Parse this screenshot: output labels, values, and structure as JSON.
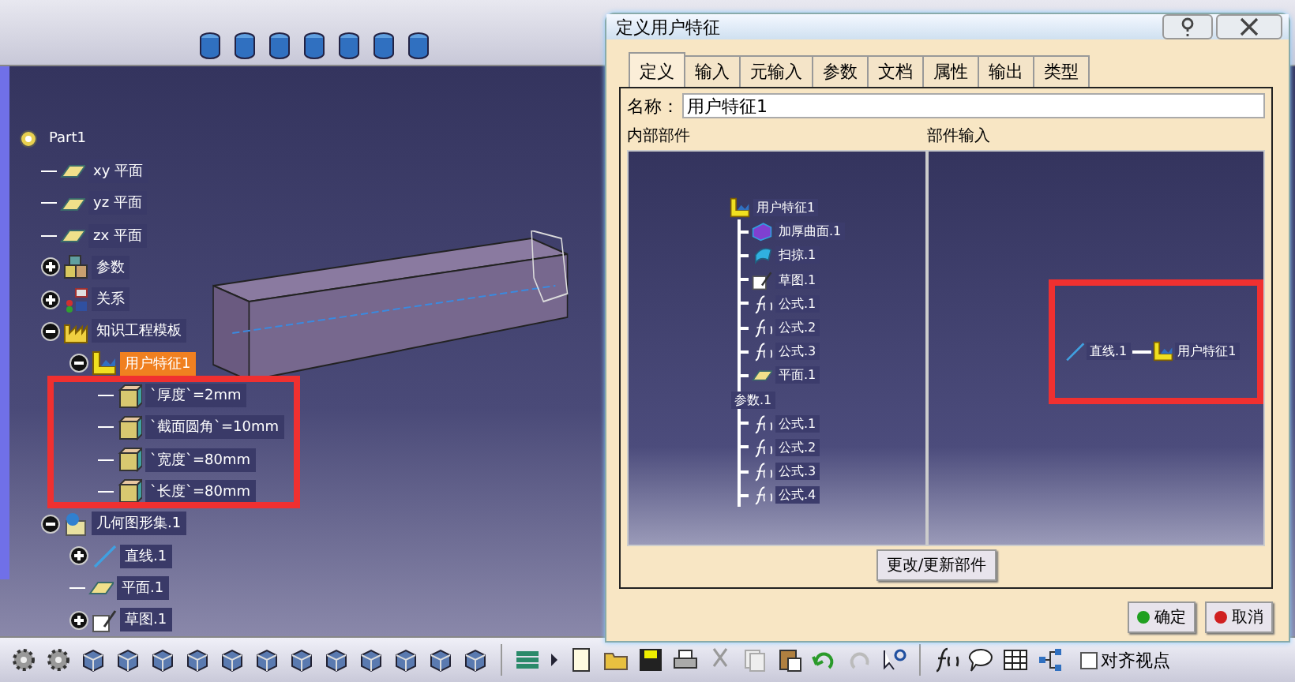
{
  "tree": {
    "label": "Part1",
    "kind": "part",
    "selected": false,
    "children": [
      {
        "label": "xy 平面",
        "kind": "plane",
        "selected": false
      },
      {
        "label": "yz 平面",
        "kind": "plane",
        "selected": false
      },
      {
        "label": "zx 平面",
        "kind": "plane",
        "selected": false
      },
      {
        "label": "参数",
        "kind": "params",
        "selected": false,
        "expanded": false
      },
      {
        "label": "关系",
        "kind": "relations",
        "selected": false,
        "expanded": false
      },
      {
        "label": "知识工程模板",
        "kind": "template",
        "selected": false,
        "expanded": true,
        "children": [
          {
            "label": "用户特征1",
            "kind": "feature",
            "selected": true,
            "expanded": true,
            "children": [
              {
                "label": "`厚度`=2mm",
                "kind": "param",
                "selected": false
              },
              {
                "label": "`截面圆角`=10mm",
                "kind": "param",
                "selected": false
              },
              {
                "label": "`宽度`=80mm",
                "kind": "param",
                "selected": false
              },
              {
                "label": "`长度`=80mm",
                "kind": "param",
                "selected": false
              }
            ]
          }
        ]
      },
      {
        "label": "几何图形集.1",
        "kind": "geoset",
        "selected": false,
        "expanded": true,
        "children": [
          {
            "label": "直线.1",
            "kind": "line",
            "selected": false,
            "expanded": false
          },
          {
            "label": "平面.1",
            "kind": "plane",
            "selected": false
          },
          {
            "label": "草图.1",
            "kind": "sketch",
            "selected": false,
            "expanded": false
          }
        ]
      }
    ]
  },
  "dialog": {
    "title": "定义用户特征",
    "tabs": [
      {
        "label": "定义",
        "selected": true
      },
      {
        "label": "输入",
        "selected": false
      },
      {
        "label": "元输入",
        "selected": false
      },
      {
        "label": "参数",
        "selected": false
      },
      {
        "label": "文档",
        "selected": false
      },
      {
        "label": "属性",
        "selected": false
      },
      {
        "label": "输出",
        "selected": false
      },
      {
        "label": "类型",
        "selected": false
      }
    ],
    "name_label": "名称：",
    "name_value": "用户特征1",
    "internal_label": "内部部件",
    "inputs_label": "部件输入",
    "internal_tree": {
      "label": "用户特征1",
      "kind": "feature",
      "children": [
        {
          "label": "加厚曲面.1",
          "kind": "surface"
        },
        {
          "label": "扫掠.1",
          "kind": "sweep"
        },
        {
          "label": "草图.1",
          "kind": "sketch"
        },
        {
          "label": "公式.1",
          "kind": "formula"
        },
        {
          "label": "公式.2",
          "kind": "formula"
        },
        {
          "label": "公式.3",
          "kind": "formula"
        },
        {
          "label": "平面.1",
          "kind": "plane"
        },
        {
          "label": "参数.1",
          "kind": "none"
        },
        {
          "label": "公式.1",
          "kind": "formula"
        },
        {
          "label": "公式.2",
          "kind": "formula"
        },
        {
          "label": "公式.3",
          "kind": "formula"
        },
        {
          "label": "公式.4",
          "kind": "formula"
        }
      ]
    },
    "inputs": [
      {
        "label": "直线.1",
        "kind": "line"
      },
      {
        "label": "用户特征1",
        "kind": "feature"
      }
    ],
    "update_button": "更改/更新部件",
    "ok_button": "确定",
    "cancel_button": "取消"
  },
  "bottom_toolbar": {
    "align_label": "对齐视点",
    "align_checked": false
  }
}
